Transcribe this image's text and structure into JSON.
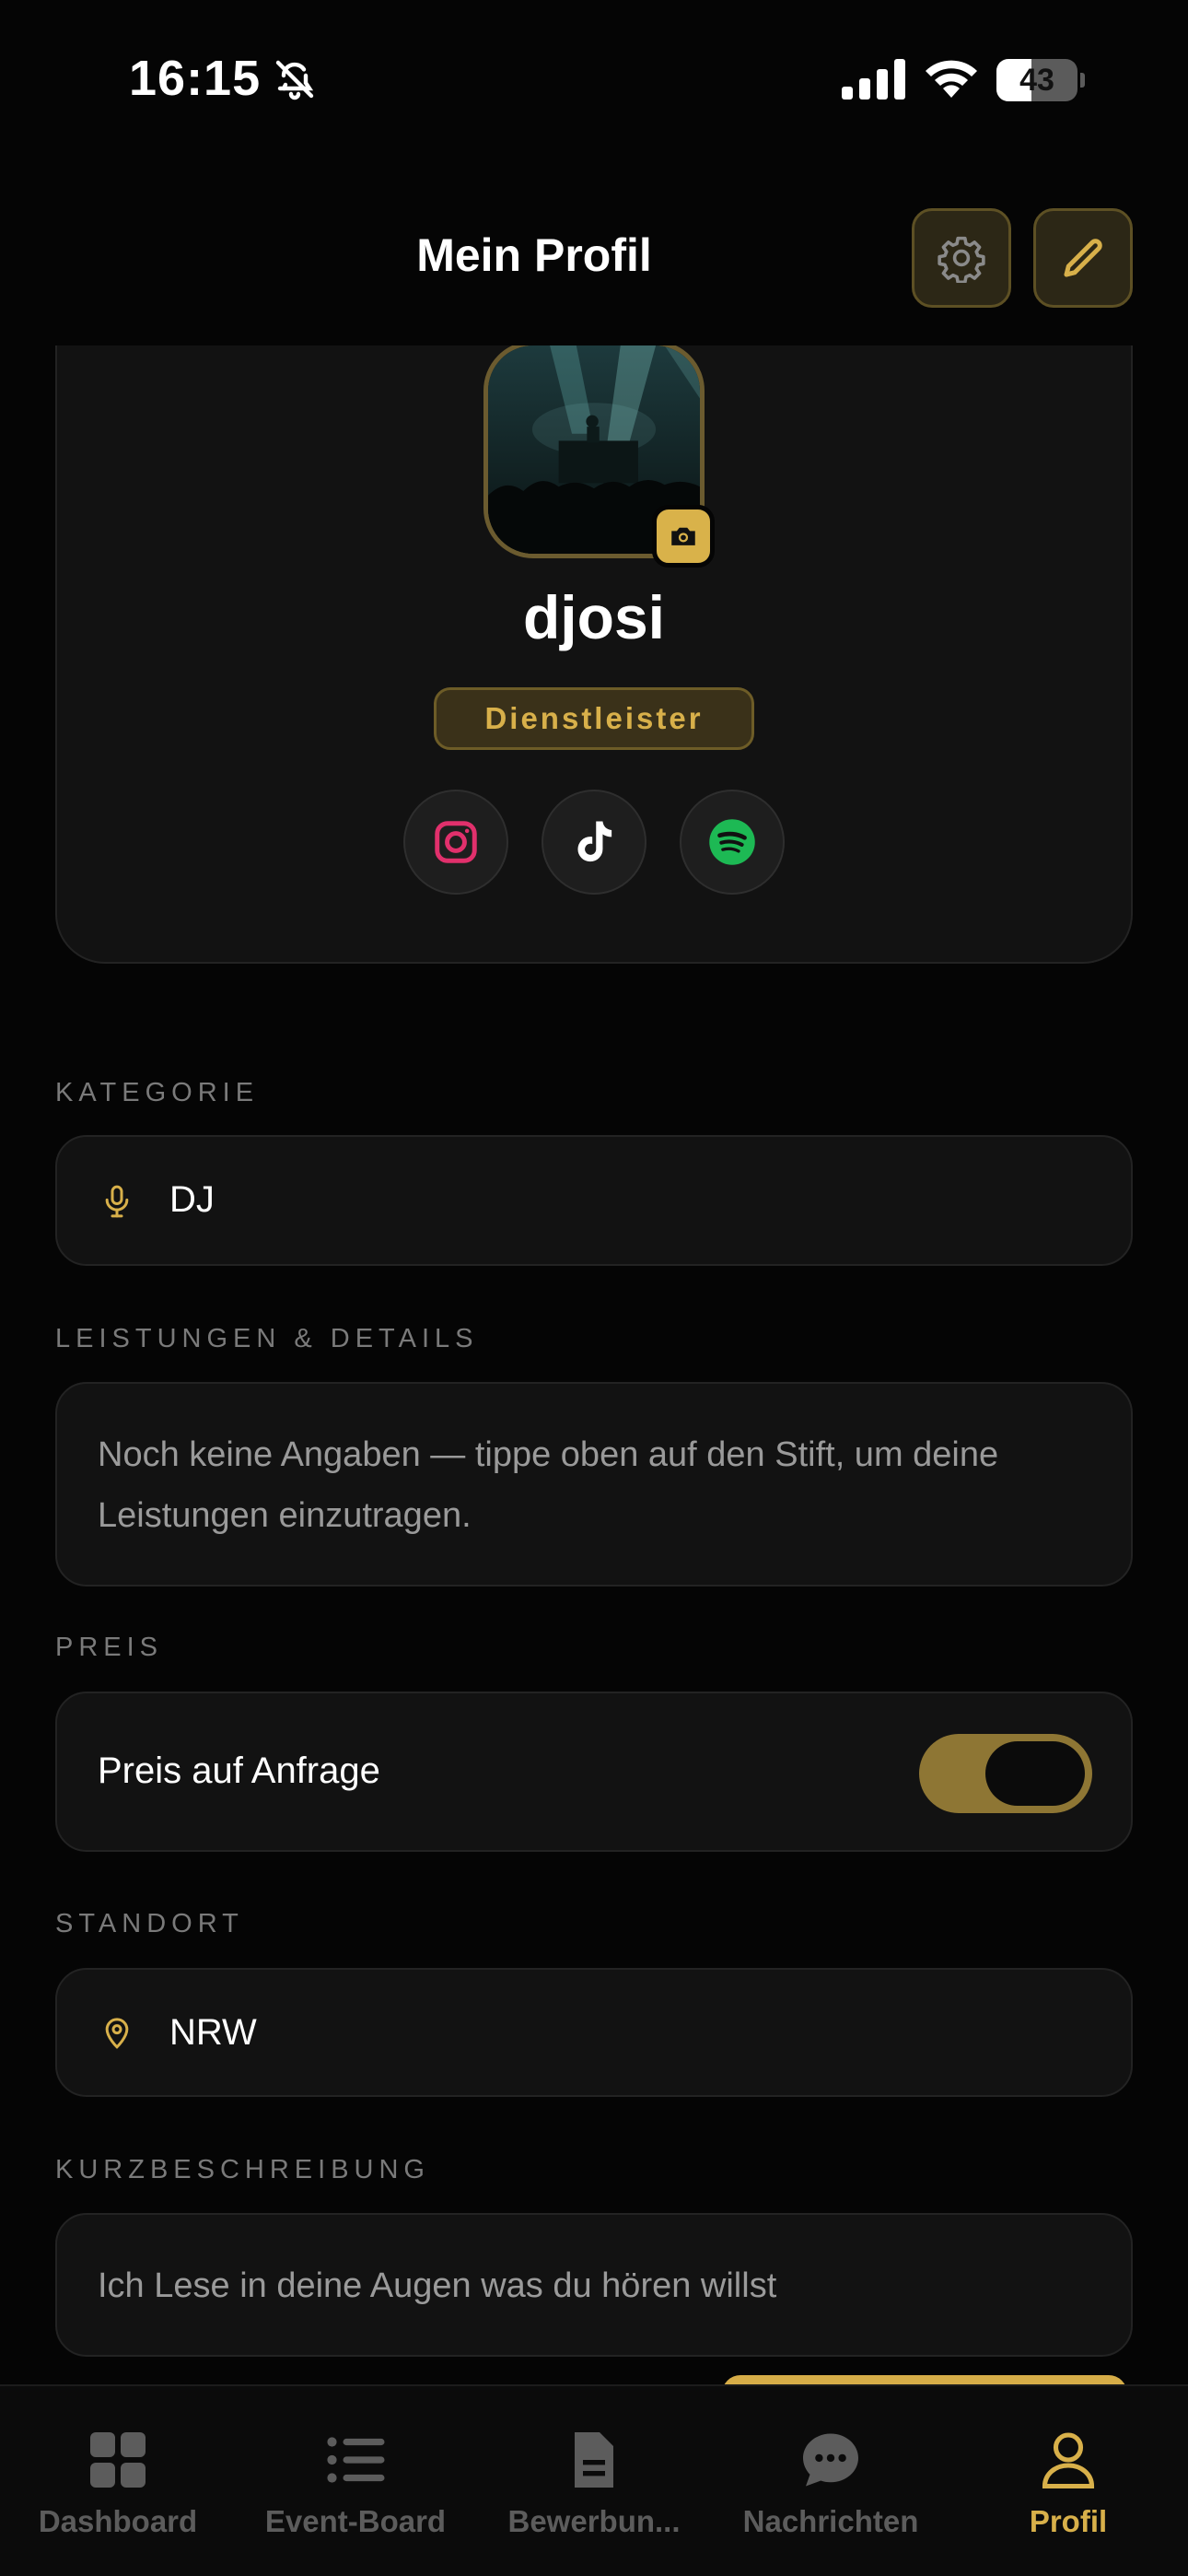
{
  "status_bar": {
    "time": "16:15",
    "battery_level": "43",
    "battery_fraction": 0.43
  },
  "header": {
    "title": "Mein Profil",
    "settings_icon": "gear-icon",
    "edit_icon": "pencil-icon"
  },
  "profile": {
    "username": "djosi",
    "role": "Dienstleister",
    "socials": [
      "instagram-icon",
      "tiktok-icon",
      "spotify-icon"
    ]
  },
  "sections": {
    "category": {
      "label": "KATEGORIE",
      "value": "DJ",
      "icon": "microphone-icon"
    },
    "services": {
      "label": "LEISTUNGEN & DETAILS",
      "text": "Noch keine Angaben — tippe oben auf den Stift, um deine Leistungen einzutragen."
    },
    "price": {
      "label": "PREIS",
      "toggle_label": "Preis auf Anfrage",
      "toggle_on": true
    },
    "location": {
      "label": "STANDORT",
      "value": "NRW",
      "icon": "map-pin-icon"
    },
    "short_description": {
      "label": "KURZBESCHREIBUNG",
      "text": "Ich Lese in deine  Augen was du hören willst"
    }
  },
  "tabs": [
    {
      "label": "Dashboard",
      "icon": "grid-icon",
      "active": false
    },
    {
      "label": "Event-Board",
      "icon": "list-icon",
      "active": false
    },
    {
      "label": "Bewerbun...",
      "icon": "document-icon",
      "active": false
    },
    {
      "label": "Nachrichten",
      "icon": "chat-bubble-icon",
      "active": false
    },
    {
      "label": "Profil",
      "icon": "person-icon",
      "active": true
    }
  ],
  "colors": {
    "accent": "#D8B04A",
    "background": "#050505",
    "card": "#121212",
    "instagram": "#E1306C",
    "spotify": "#1DB954"
  }
}
